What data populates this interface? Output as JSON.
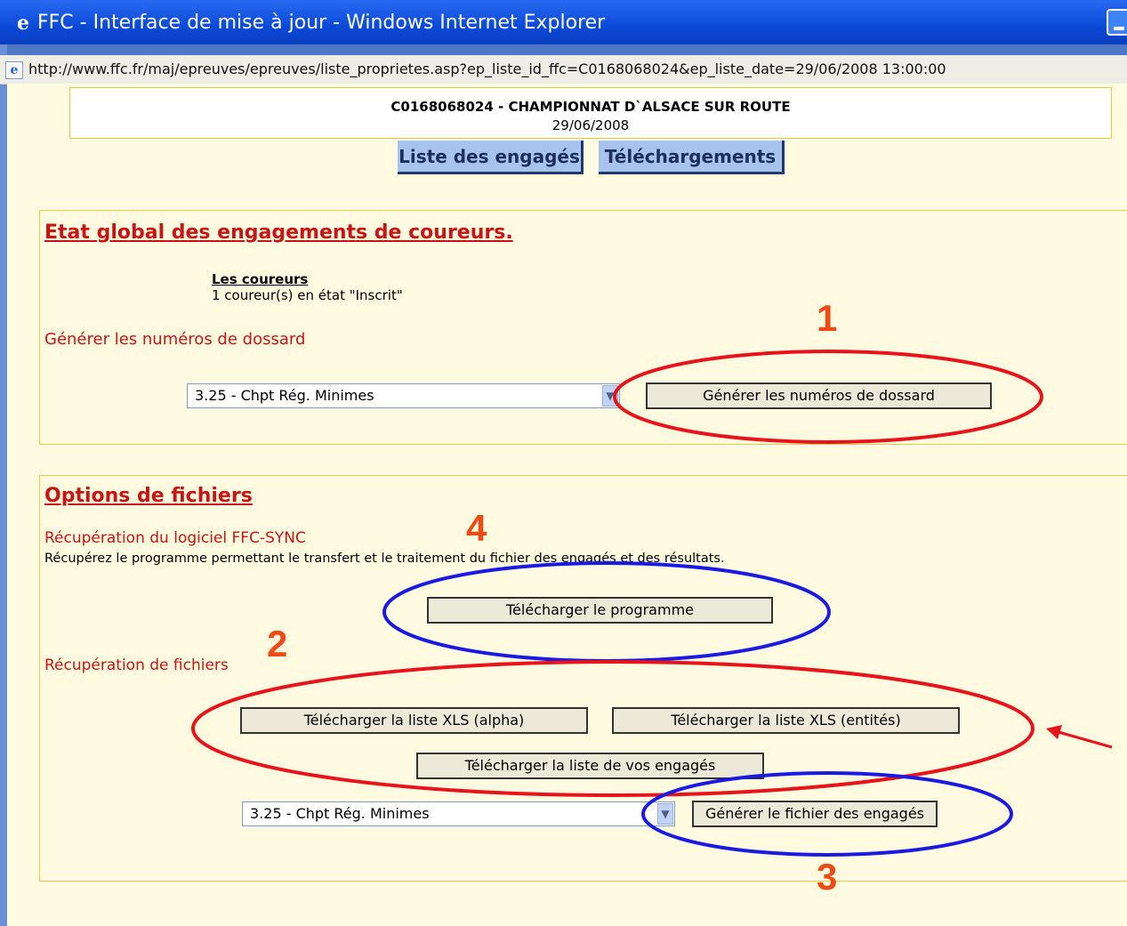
{
  "window": {
    "title": "FFC - Interface de mise à jour - Windows Internet Explorer",
    "address": "http://www.ffc.fr/maj/epreuves/epreuves/liste_proprietes.asp?ep_liste_id_ffc=C0168068024&ep_liste_date=29/06/2008 13:00:00"
  },
  "header": {
    "event": "C0168068024 - CHAMPIONNAT D`ALSACE SUR ROUTE",
    "date": "29/06/2008"
  },
  "nav": {
    "engaged_list": "Liste des engagés",
    "downloads": "Téléchargements"
  },
  "etat": {
    "title": "Etat global des engagements de coureurs.",
    "runners_label": "Les coureurs",
    "runners_status": "1 coureur(s) en état \"Inscrit\"",
    "generate_heading": "Générer les numéros de dossard",
    "category_select": "3.25 - Chpt Rég. Minimes",
    "generate_button": "Générer les numéros de dossard"
  },
  "options": {
    "title": "Options de fichiers",
    "sync_heading": "Récupération du logiciel FFC-SYNC",
    "sync_desc": "Récupérez le programme permettant le transfert et le traitement du fichier des engagés et des résultats.",
    "download_program": "Télécharger le programme",
    "files_heading": "Récupération de fichiers",
    "xls_alpha": "Télécharger la liste XLS (alpha)",
    "xls_entities": "Télécharger la liste XLS (entités)",
    "engaged_list": "Télécharger la liste de vos engagés",
    "category_select": "3.25 - Chpt Rég. Minimes",
    "generate_file": "Générer le fichier des engagés"
  },
  "annotations": {
    "n1": "1",
    "n2": "2",
    "n3": "3",
    "n4": "4",
    "red": "#e8141c",
    "blue": "#1a1ae0",
    "orange": "#f04a16"
  }
}
